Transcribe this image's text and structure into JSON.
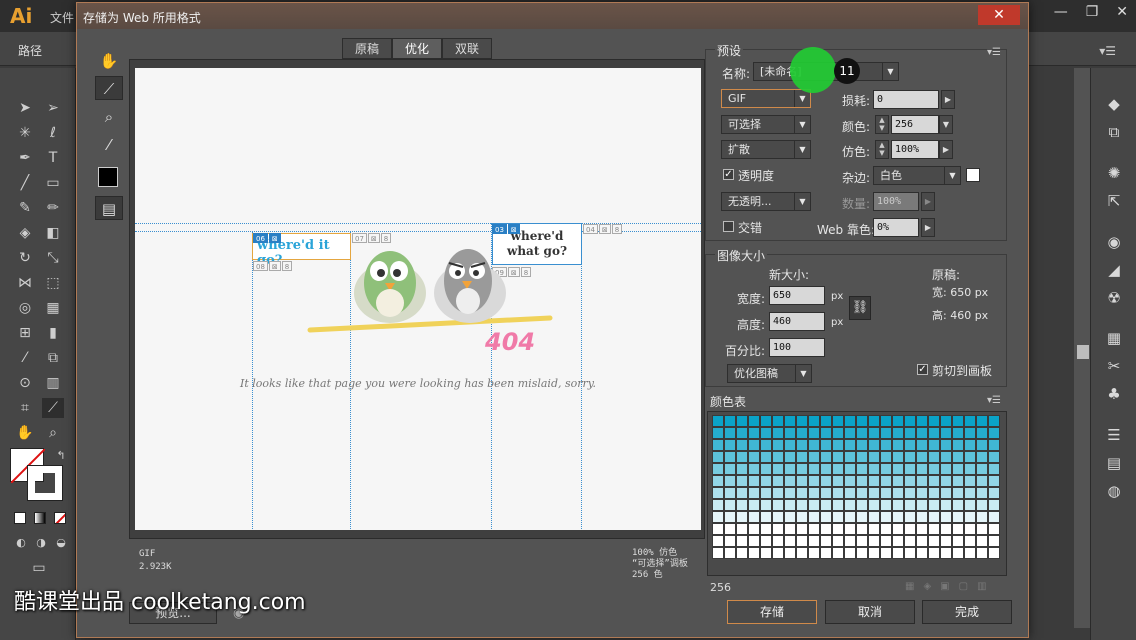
{
  "app": {
    "logo": "Ai",
    "menu_file": "文件",
    "control_path": "路径",
    "window_controls": [
      "—",
      "❐",
      "✕"
    ]
  },
  "dialog": {
    "title": "存储为 Web 所用格式",
    "close": "✕",
    "tabs": [
      "原稿",
      "优化",
      "双联"
    ],
    "active_tab": "优化"
  },
  "preview": {
    "bubble_left": "where'd it go?",
    "bubble_right_line1": "where'd",
    "bubble_right_line2": "what go?",
    "code": "404",
    "message": "It looks like that page you were looking has been mislaid, sorry.",
    "slices": [
      {
        "num": "06",
        "selected": true
      },
      {
        "num": "07",
        "selected": false
      },
      {
        "num": "03",
        "selected": true
      },
      {
        "num": "04",
        "selected": false
      },
      {
        "num": "08",
        "selected": false
      },
      {
        "num": "09",
        "selected": false
      }
    ],
    "info_left": [
      "GIF",
      "2.923K"
    ],
    "info_right": [
      "100% 仿色",
      "“可选择”调板",
      "256 色"
    ],
    "preview_button": "预览..."
  },
  "presets": {
    "group_label": "预设",
    "name_label": "名称:",
    "name_value": "[未命名]",
    "format": "GIF",
    "loss_label": "损耗:",
    "loss_value": "0",
    "reduction": "可选择",
    "colors_label": "颜色:",
    "colors_value": "256",
    "dither_algo": "扩散",
    "dither_label": "仿色:",
    "dither_value": "100%",
    "transparency_label": "透明度",
    "transparency_checked": true,
    "matte_label": "杂边:",
    "matte_value": "白色",
    "transparency_dither": "无透明...",
    "amount_label": "数量:",
    "amount_value": "100%",
    "interlaced_label": "交错",
    "interlaced_checked": false,
    "web_snap_label": "Web 靠色:",
    "web_snap_value": "0%"
  },
  "image_size": {
    "group_label": "图像大小",
    "new_size_label": "新大小:",
    "width_label": "宽度:",
    "width_value": "650",
    "height_label": "高度:",
    "height_value": "460",
    "unit": "px",
    "percent_label": "百分比:",
    "percent_value": "100",
    "quality": "优化图稿",
    "original_label": "原稿:",
    "orig_width": "宽: 650 px",
    "orig_height": "高: 460 px",
    "clip_label": "剪切到画板",
    "clip_checked": true
  },
  "color_table": {
    "label": "颜色表",
    "count": "256",
    "menu_icon": "menu-icon"
  },
  "buttons": {
    "save": "存储",
    "cancel": "取消",
    "done": "完成"
  },
  "annotation": {
    "step": "11"
  },
  "watermark": "酷课堂出品 coolketang.com",
  "colors": {
    "accent": "#d08a4a",
    "slice_blue": "#2a7fc4",
    "cyan_dark": "#0aa3c8",
    "highlight_green": "#22cc33"
  }
}
